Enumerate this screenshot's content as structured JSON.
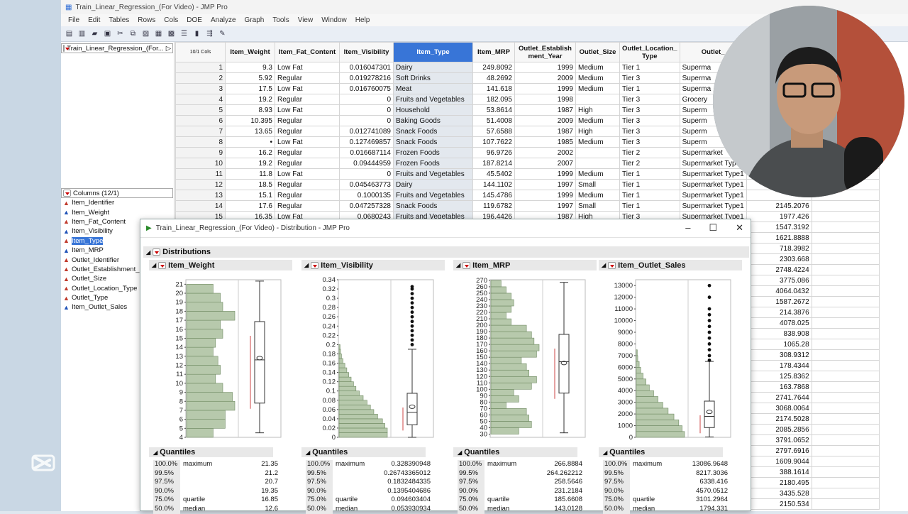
{
  "app": {
    "window_title": "Train_Linear_Regression_(For Video) - JMP Pro",
    "menu": [
      "File",
      "Edit",
      "Tables",
      "Rows",
      "Cols",
      "DOE",
      "Analyze",
      "Graph",
      "Tools",
      "View",
      "Window",
      "Help"
    ]
  },
  "left_panel": {
    "table_name": "Train_Linear_Regression_(For...",
    "columns_header": "Columns (12/1)",
    "columns": [
      {
        "name": "Item_Identifier",
        "type": "nominal"
      },
      {
        "name": "Item_Weight",
        "type": "continuous"
      },
      {
        "name": "Item_Fat_Content",
        "type": "nominal"
      },
      {
        "name": "Item_Visibility",
        "type": "continuous"
      },
      {
        "name": "Item_Type",
        "type": "nominal",
        "selected": true
      },
      {
        "name": "Item_MRP",
        "type": "continuous"
      },
      {
        "name": "Outlet_Identifier",
        "type": "nominal"
      },
      {
        "name": "Outlet_Establishment_",
        "type": "nominal"
      },
      {
        "name": "Outlet_Size",
        "type": "nominal"
      },
      {
        "name": "Outlet_Location_Type",
        "type": "nominal"
      },
      {
        "name": "Outlet_Type",
        "type": "nominal"
      },
      {
        "name": "Item_Outlet_Sales",
        "type": "continuous"
      }
    ]
  },
  "grid": {
    "corner_label": "10/1 Cols",
    "headers": [
      "Item_Weight",
      "Item_Fat_Content",
      "Item_Visibility",
      "Item_Type",
      "Item_MRP",
      "Outlet_Establishment_Year",
      "Outlet_Size",
      "Outlet_Location_Type",
      "Outlet_Type"
    ],
    "header_display": [
      "Item_Weight",
      "Item_Fat_Content",
      "Item_Visibility",
      "Item_Type",
      "Item_MRP",
      "Outlet_Establish ment_Year",
      "Outlet_Size",
      "Outlet_Location_ Type",
      "Outlet_"
    ],
    "rows": [
      [
        "1",
        "9.3",
        "Low Fat",
        "0.016047301",
        "Dairy",
        "249.8092",
        "1999",
        "Medium",
        "Tier 1",
        "Superma"
      ],
      [
        "2",
        "5.92",
        "Regular",
        "0.019278216",
        "Soft Drinks",
        "48.2692",
        "2009",
        "Medium",
        "Tier 3",
        "Superma"
      ],
      [
        "3",
        "17.5",
        "Low Fat",
        "0.016760075",
        "Meat",
        "141.618",
        "1999",
        "Medium",
        "Tier 1",
        "Superma"
      ],
      [
        "4",
        "19.2",
        "Regular",
        "0",
        "Fruits and Vegetables",
        "182.095",
        "1998",
        "",
        "Tier 3",
        "Grocery"
      ],
      [
        "5",
        "8.93",
        "Low Fat",
        "0",
        "Household",
        "53.8614",
        "1987",
        "High",
        "Tier 3",
        "Superm"
      ],
      [
        "6",
        "10.395",
        "Regular",
        "0",
        "Baking Goods",
        "51.4008",
        "2009",
        "Medium",
        "Tier 3",
        "Superm"
      ],
      [
        "7",
        "13.65",
        "Regular",
        "0.012741089",
        "Snack Foods",
        "57.6588",
        "1987",
        "High",
        "Tier 3",
        "Superm"
      ],
      [
        "8",
        "•",
        "Low Fat",
        "0.127469857",
        "Snack Foods",
        "107.7622",
        "1985",
        "Medium",
        "Tier 3",
        "Superm"
      ],
      [
        "9",
        "16.2",
        "Regular",
        "0.016687114",
        "Frozen Foods",
        "96.9726",
        "2002",
        "",
        "Tier 2",
        "Supermarket"
      ],
      [
        "10",
        "19.2",
        "Regular",
        "0.09444959",
        "Frozen Foods",
        "187.8214",
        "2007",
        "",
        "Tier 2",
        "Supermarket Type1"
      ],
      [
        "11",
        "11.8",
        "Low Fat",
        "0",
        "Fruits and Vegetables",
        "45.5402",
        "1999",
        "Medium",
        "Tier 1",
        "Supermarket Type1"
      ],
      [
        "12",
        "18.5",
        "Regular",
        "0.045463773",
        "Dairy",
        "144.1102",
        "1997",
        "Small",
        "Tier 1",
        "Supermarket Type1"
      ],
      [
        "13",
        "15.1",
        "Regular",
        "0.1000135",
        "Fruits and Vegetables",
        "145.4786",
        "1999",
        "Medium",
        "Tier 1",
        "Supermarket Type1"
      ],
      [
        "14",
        "17.6",
        "Regular",
        "0.047257328",
        "Snack Foods",
        "119.6782",
        "1997",
        "Small",
        "Tier 1",
        "Supermarket Type1"
      ],
      [
        "15",
        "16.35",
        "Low Fat",
        "0.0680243",
        "Fruits and Vegetables",
        "196.4426",
        "1987",
        "High",
        "Tier 3",
        "Supermarket Type1"
      ]
    ],
    "sales_column_visible": [
      "2145.2076",
      "1977.426",
      "1547.3192",
      "1621.8888",
      "718.3982",
      "2303.668",
      "2748.4224",
      "3775.086",
      "4064.0432",
      "1587.2672",
      "214.3876",
      "4078.025",
      "838.908",
      "1065.28",
      "308.9312",
      "178.4344",
      "125.8362",
      "163.7868",
      "2741.7644",
      "3068.0064",
      "2174.5028",
      "2085.2856",
      "3791.0652",
      "2797.6916",
      "1609.9044",
      "388.1614",
      "2180.495",
      "3435.528",
      "2150.534"
    ]
  },
  "distribution_window": {
    "title": "Train_Linear_Regression_(For Video) - Distribution - JMP Pro",
    "heading": "Distributions",
    "quantiles_label": "Quantiles",
    "quantile_pcts": [
      "100.0%",
      "99.5%",
      "97.5%",
      "90.0%",
      "75.0%",
      "50.0%"
    ],
    "quantile_names": [
      "maximum",
      "",
      "",
      "",
      "quartile",
      "median"
    ],
    "panels": [
      {
        "title": "Item_Weight",
        "axis_ticks": [
          "21",
          "20",
          "19",
          "18",
          "17",
          "16",
          "15",
          "14",
          "13",
          "12",
          "11",
          "10",
          "9",
          "8",
          "7",
          "6",
          "5",
          "4"
        ],
        "quantiles": [
          "21.35",
          "21.2",
          "20.7",
          "19.35",
          "16.85",
          "12.6"
        ]
      },
      {
        "title": "Item_Visibility",
        "axis_ticks": [
          "0.34",
          "0.32",
          "0.3",
          "0.28",
          "0.26",
          "0.24",
          "0.22",
          "0.2",
          "0.18",
          "0.16",
          "0.14",
          "0.12",
          "0.1",
          "0.08",
          "0.06",
          "0.04",
          "0.02",
          "0"
        ],
        "quantiles": [
          "0.328390948",
          "0.26743365012",
          "0.1832484335",
          "0.1395404686",
          "0.094603404",
          "0.053930934"
        ]
      },
      {
        "title": "Item_MRP",
        "axis_ticks": [
          "270",
          "260",
          "250",
          "240",
          "230",
          "220",
          "210",
          "200",
          "190",
          "180",
          "170",
          "160",
          "150",
          "140",
          "130",
          "120",
          "110",
          "100",
          "90",
          "80",
          "70",
          "60",
          "50",
          "40",
          "30"
        ],
        "quantiles": [
          "266.8884",
          "264.262212",
          "258.5646",
          "231.2184",
          "185.6608",
          "143.0128"
        ]
      },
      {
        "title": "Item_Outlet_Sales",
        "axis_ticks": [
          "13000",
          "12000",
          "11000",
          "10000",
          "9000",
          "8000",
          "7000",
          "6000",
          "5000",
          "4000",
          "3000",
          "2000",
          "1000",
          "0"
        ],
        "quantiles": [
          "13086.9648",
          "8217.3036",
          "6338.416",
          "4570.0512",
          "3101.2964",
          "1794.331"
        ]
      }
    ]
  },
  "chart_data": [
    {
      "type": "bar",
      "title": "Item_Weight",
      "orientation": "horizontal histogram",
      "ylim": [
        4,
        21.5
      ],
      "bins": [
        4.5,
        5.5,
        6.5,
        7.5,
        8.5,
        9.5,
        10.5,
        11.5,
        12.5,
        13.5,
        14.5,
        15.5,
        16.5,
        17.5,
        18.5,
        19.5,
        20.5
      ],
      "values": [
        55,
        80,
        80,
        100,
        95,
        75,
        60,
        70,
        65,
        55,
        60,
        75,
        70,
        100,
        75,
        70,
        55
      ]
    },
    {
      "type": "bar",
      "title": "Item_Visibility",
      "orientation": "horizontal histogram",
      "ylim": [
        0,
        0.34
      ],
      "bins": [
        0.005,
        0.015,
        0.025,
        0.035,
        0.045,
        0.055,
        0.065,
        0.075,
        0.085,
        0.095,
        0.105,
        0.115,
        0.125,
        0.135,
        0.145,
        0.155,
        0.165,
        0.175,
        0.185,
        0.195
      ],
      "values": [
        100,
        100,
        95,
        90,
        80,
        72,
        65,
        58,
        50,
        42,
        35,
        30,
        25,
        20,
        16,
        12,
        8,
        5,
        3,
        2
      ]
    },
    {
      "type": "bar",
      "title": "Item_MRP",
      "orientation": "horizontal histogram",
      "ylim": [
        30,
        270
      ],
      "bins": [
        35,
        45,
        55,
        65,
        75,
        85,
        95,
        105,
        115,
        125,
        135,
        145,
        155,
        165,
        175,
        185,
        195,
        205,
        215,
        225,
        235,
        245,
        255,
        265
      ],
      "values": [
        55,
        80,
        75,
        70,
        30,
        55,
        45,
        80,
        90,
        75,
        70,
        60,
        90,
        95,
        85,
        80,
        70,
        40,
        30,
        40,
        45,
        40,
        30,
        20
      ]
    },
    {
      "type": "bar",
      "title": "Item_Outlet_Sales",
      "orientation": "horizontal histogram",
      "ylim": [
        0,
        13500
      ],
      "bins": [
        250,
        750,
        1250,
        1750,
        2250,
        2750,
        3250,
        3750,
        4250,
        4750,
        5250,
        5750,
        6250,
        6750,
        7250
      ],
      "values": [
        100,
        95,
        88,
        78,
        66,
        55,
        45,
        36,
        27,
        20,
        14,
        9,
        6,
        3,
        2
      ]
    }
  ]
}
